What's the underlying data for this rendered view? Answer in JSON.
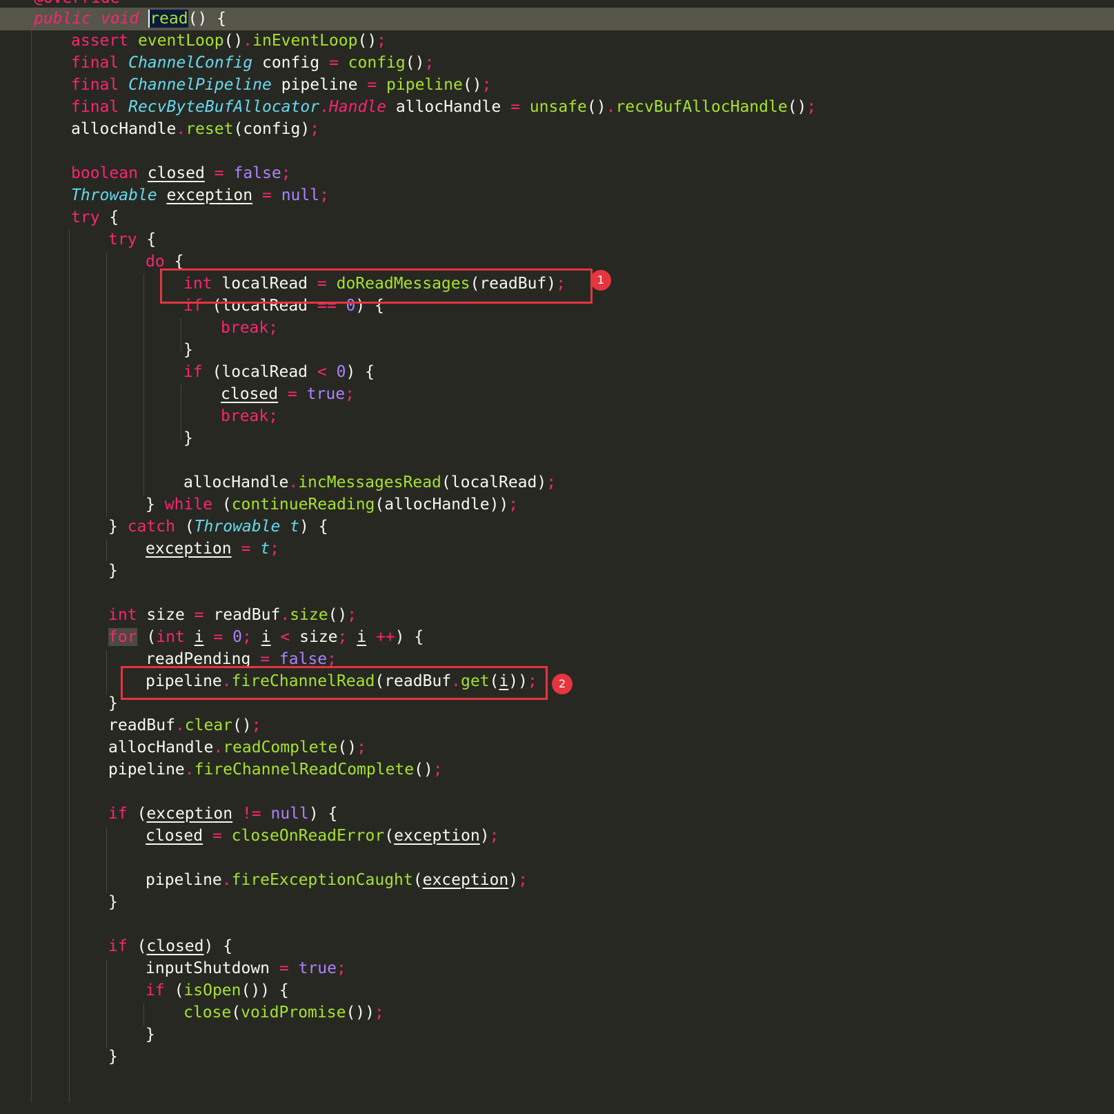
{
  "annotation": "@Override",
  "method_sig": {
    "kw_public": "public",
    "kw_void": "void",
    "name": "read",
    "rest": "() {"
  },
  "markers": {
    "m1": "1",
    "m2": "2"
  },
  "lines": {
    "l2": {
      "a": "assert",
      "b": "eventLoop",
      "c": "()",
      "d": ".",
      "e": "inEventLoop",
      "f": "()",
      "g": ";"
    },
    "l3": {
      "a": "final",
      "b": "ChannelConfig",
      "c": "config",
      "d": "=",
      "e": "config",
      "f": "()",
      "g": ";"
    },
    "l4": {
      "a": "final",
      "b": "ChannelPipeline",
      "c": "pipeline",
      "d": "=",
      "e": "pipeline",
      "f": "()",
      "g": ";"
    },
    "l5": {
      "a": "final",
      "b": "RecvByteBufAllocator",
      "c": ".",
      "d": "Handle",
      "e": "allocHandle",
      "f": "=",
      "g": "unsafe",
      "h": "()",
      "i": ".",
      "j": "recvBufAllocHandle",
      "k": "()",
      "l": ";"
    },
    "l6": {
      "a": "allocHandle",
      "b": ".",
      "c": "reset",
      "d": "(config)",
      "e": ";"
    },
    "l7": {
      "a": "boolean",
      "b": "closed",
      "c": "=",
      "d": "false",
      "e": ";"
    },
    "l8": {
      "a": "Throwable",
      "b": "exception",
      "c": "=",
      "d": "null",
      "e": ";"
    },
    "l9": {
      "a": "try",
      "b": "{"
    },
    "l10": {
      "a": "try",
      "b": "{"
    },
    "l11": {
      "a": "do",
      "b": "{"
    },
    "l12": {
      "a": "int",
      "b": "localRead",
      "c": "=",
      "d": "doReadMessages",
      "e": "(readBuf)",
      "f": ";"
    },
    "l13": {
      "a": "if",
      "b": "(localRead",
      "c": "==",
      "d": "0",
      "e": ") {"
    },
    "l14": {
      "a": "break",
      "b": ";"
    },
    "l15": {
      "a": "}"
    },
    "l16": {
      "a": "if",
      "b": "(localRead",
      "c": "<",
      "d": "0",
      "e": ") {"
    },
    "l17": {
      "a": "closed",
      "b": "=",
      "c": "true",
      "d": ";"
    },
    "l18": {
      "a": "break",
      "b": ";"
    },
    "l19": {
      "a": "}"
    },
    "l20": {
      "a": "allocHandle",
      "b": ".",
      "c": "incMessagesRead",
      "d": "(localRead)",
      "e": ";"
    },
    "l21": {
      "a": "}",
      "b": "while",
      "c": "(",
      "d": "continueReading",
      "e": "(allocHandle))",
      "f": ";"
    },
    "l22": {
      "a": "}",
      "b": "catch",
      "c": "(",
      "d": "Throwable",
      "e": "t",
      "f": ") {"
    },
    "l23": {
      "a": "exception",
      "b": "=",
      "c": "t",
      "d": ";"
    },
    "l24": {
      "a": "}"
    },
    "l25": {
      "a": "int",
      "b": "size",
      "c": "=",
      "d": "readBuf",
      "e": ".",
      "f": "size",
      "g": "()",
      "h": ";"
    },
    "l26": {
      "a": "for",
      "b": "(",
      "c": "int",
      "d": "i",
      "e": "=",
      "f": "0",
      "g": ";",
      "h": "i",
      "i": "<",
      "j": "size",
      "k": ";",
      "l": "i",
      "m": "++",
      "n": ") {"
    },
    "l27": {
      "a": "readPending",
      "b": "=",
      "c": "false",
      "d": ";"
    },
    "l28": {
      "a": "pipeline",
      "b": ".",
      "c": "fireChannelRead",
      "d": "(readBuf",
      "e": ".",
      "f": "get",
      "g": "(",
      "h": "i",
      "i": "))",
      "j": ";"
    },
    "l29": {
      "a": "}"
    },
    "l30": {
      "a": "readBuf",
      "b": ".",
      "c": "clear",
      "d": "()",
      "e": ";"
    },
    "l31": {
      "a": "allocHandle",
      "b": ".",
      "c": "readComplete",
      "d": "()",
      "e": ";"
    },
    "l32": {
      "a": "pipeline",
      "b": ".",
      "c": "fireChannelReadComplete",
      "d": "()",
      "e": ";"
    },
    "l33": {
      "a": "if",
      "b": "(",
      "c": "exception",
      "d": "!=",
      "e": "null",
      "f": ") {"
    },
    "l34": {
      "a": "closed",
      "b": "=",
      "c": "closeOnReadError",
      "d": "(",
      "e": "exception",
      "f": ")",
      "g": ";"
    },
    "l35": {
      "a": "pipeline",
      "b": ".",
      "c": "fireExceptionCaught",
      "d": "(",
      "e": "exception",
      "f": ")",
      "g": ";"
    },
    "l36": {
      "a": "}"
    },
    "l37": {
      "a": "if",
      "b": "(",
      "c": "closed",
      "d": ") {"
    },
    "l38": {
      "a": "inputShutdown",
      "b": "=",
      "c": "true",
      "d": ";"
    },
    "l39": {
      "a": "if",
      "b": "(",
      "c": "isOpen",
      "d": "()) {"
    },
    "l40": {
      "a": "close",
      "b": "(",
      "c": "voidPromise",
      "d": "())",
      "e": ";"
    },
    "l41": {
      "a": "}"
    },
    "l42": {
      "a": "}"
    }
  }
}
